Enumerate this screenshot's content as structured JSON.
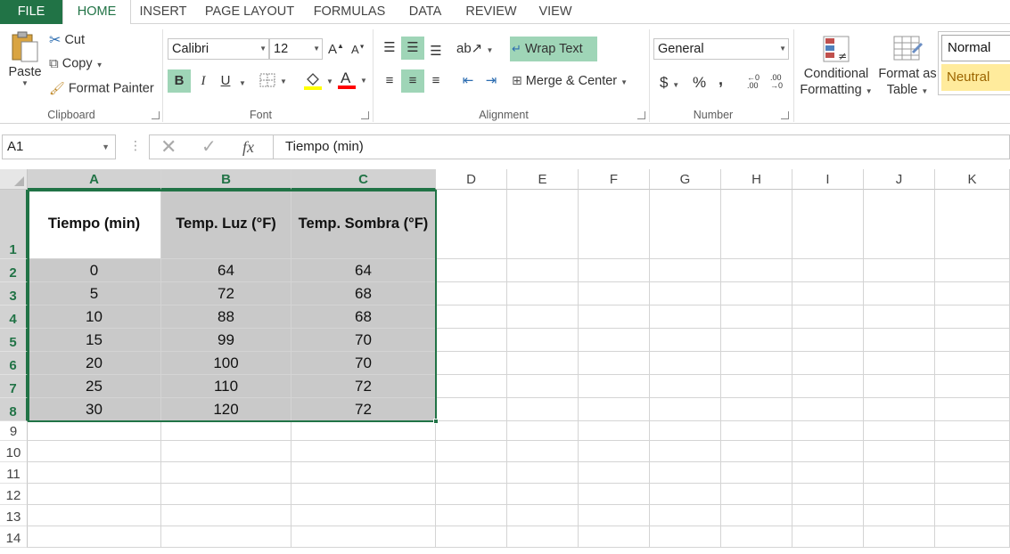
{
  "tabs": [
    "FILE",
    "HOME",
    "INSERT",
    "PAGE LAYOUT",
    "FORMULAS",
    "DATA",
    "REVIEW",
    "VIEW"
  ],
  "active_tab": "HOME",
  "ribbon": {
    "clipboard": {
      "paste": "Paste",
      "cut": "Cut",
      "copy": "Copy",
      "format_painter": "Format Painter",
      "label": "Clipboard"
    },
    "font": {
      "name": "Calibri",
      "size": "12",
      "bold": "B",
      "italic": "I",
      "underline": "U",
      "label": "Font",
      "highlight_color": "#ffff00",
      "font_color": "#ff0000"
    },
    "alignment": {
      "wrap_text": "Wrap Text",
      "merge_center": "Merge & Center",
      "label": "Alignment"
    },
    "number": {
      "format": "General",
      "currency": "$",
      "percent": "%",
      "comma": ",",
      "label": "Number"
    },
    "styles": {
      "conditional": [
        "Conditional",
        "Formatting"
      ],
      "format_as": [
        "Format as",
        "Table"
      ],
      "normal": "Normal",
      "neutral": "Neutral"
    }
  },
  "formula_bar": {
    "name_box": "A1",
    "content": "Tiempo (min)"
  },
  "sheet": {
    "columns": [
      "A",
      "B",
      "C",
      "D",
      "E",
      "F",
      "G",
      "H",
      "I",
      "J",
      "K"
    ],
    "rows": [
      "1",
      "2",
      "3",
      "4",
      "5",
      "6",
      "7",
      "8",
      "9",
      "10",
      "11",
      "12",
      "13",
      "14"
    ],
    "headers": [
      "Tiempo (min)",
      "Temp. Luz (°F)",
      "Temp. Sombra (°F)"
    ],
    "data": [
      [
        "0",
        "64",
        "64"
      ],
      [
        "5",
        "72",
        "68"
      ],
      [
        "10",
        "88",
        "68"
      ],
      [
        "15",
        "99",
        "70"
      ],
      [
        "20",
        "100",
        "70"
      ],
      [
        "25",
        "110",
        "72"
      ],
      [
        "30",
        "120",
        "72"
      ]
    ],
    "accent_color": "#217346",
    "selection_fill": "#c9c9c9"
  }
}
